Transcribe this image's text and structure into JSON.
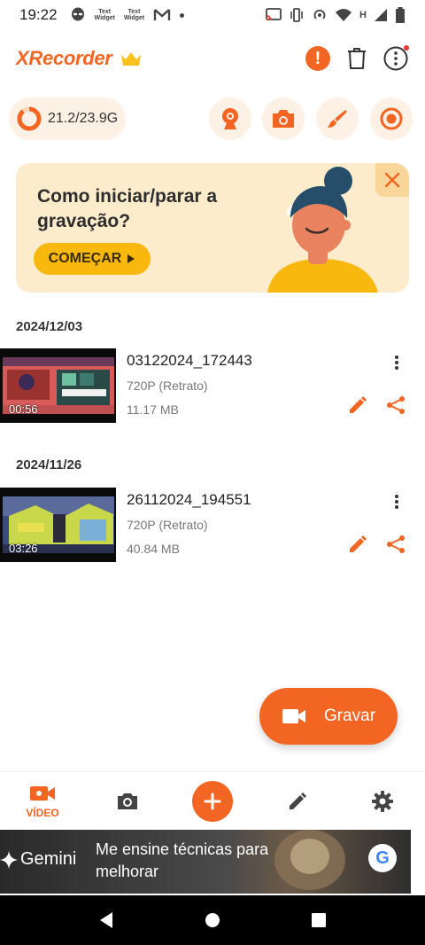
{
  "status_bar": {
    "time": "19:22",
    "mini_icon_1": "Text\nWidget",
    "mini_icon_2": "Text\nWidget",
    "icons": [
      "alien-icon",
      "text-widget-icon",
      "text-widget-icon",
      "gmail-icon",
      "dot-icon",
      "cast-icon",
      "vibrate-icon",
      "hotspot-icon",
      "wifi-icon",
      "network-h-icon",
      "signal-icon",
      "battery-icon"
    ]
  },
  "app": {
    "name": "XRecorder",
    "accent": "#f26522",
    "premium_icon": "crown-icon",
    "actions": [
      "alert-icon",
      "trash-icon",
      "more-vertical-icon"
    ]
  },
  "storage": {
    "text": "21.2/23.9G",
    "used_fraction": 0.887
  },
  "quick_actions": [
    "webcam-icon",
    "camera-icon",
    "brush-icon",
    "record-icon"
  ],
  "banner": {
    "title": "Como iniciar/parar a gravação?",
    "button_label": "COMEÇAR",
    "close_icon": "close-icon"
  },
  "recordings": [
    {
      "date": "2024/12/03",
      "name": "03122024_172443",
      "resolution": "720P (Retrato)",
      "size": "11.17 MB",
      "duration": "00:56"
    },
    {
      "date": "2024/11/26",
      "name": "26112024_194551",
      "resolution": "720P (Retrato)",
      "size": "40.84 MB",
      "duration": "03:26"
    }
  ],
  "fab": {
    "label": "Gravar",
    "icon": "video-camera-icon"
  },
  "bottom_nav": {
    "video_label": "VÍDEO",
    "items": [
      "video-icon",
      "camera-icon",
      "add-icon",
      "pencil-icon",
      "gear-icon"
    ]
  },
  "ad": {
    "brand": "Gemini",
    "text": "Me ensine técnicas para melhorar",
    "logo": "google-g-icon",
    "google_letter": "G"
  },
  "system_nav": [
    "back-icon",
    "home-icon",
    "recents-icon"
  ]
}
